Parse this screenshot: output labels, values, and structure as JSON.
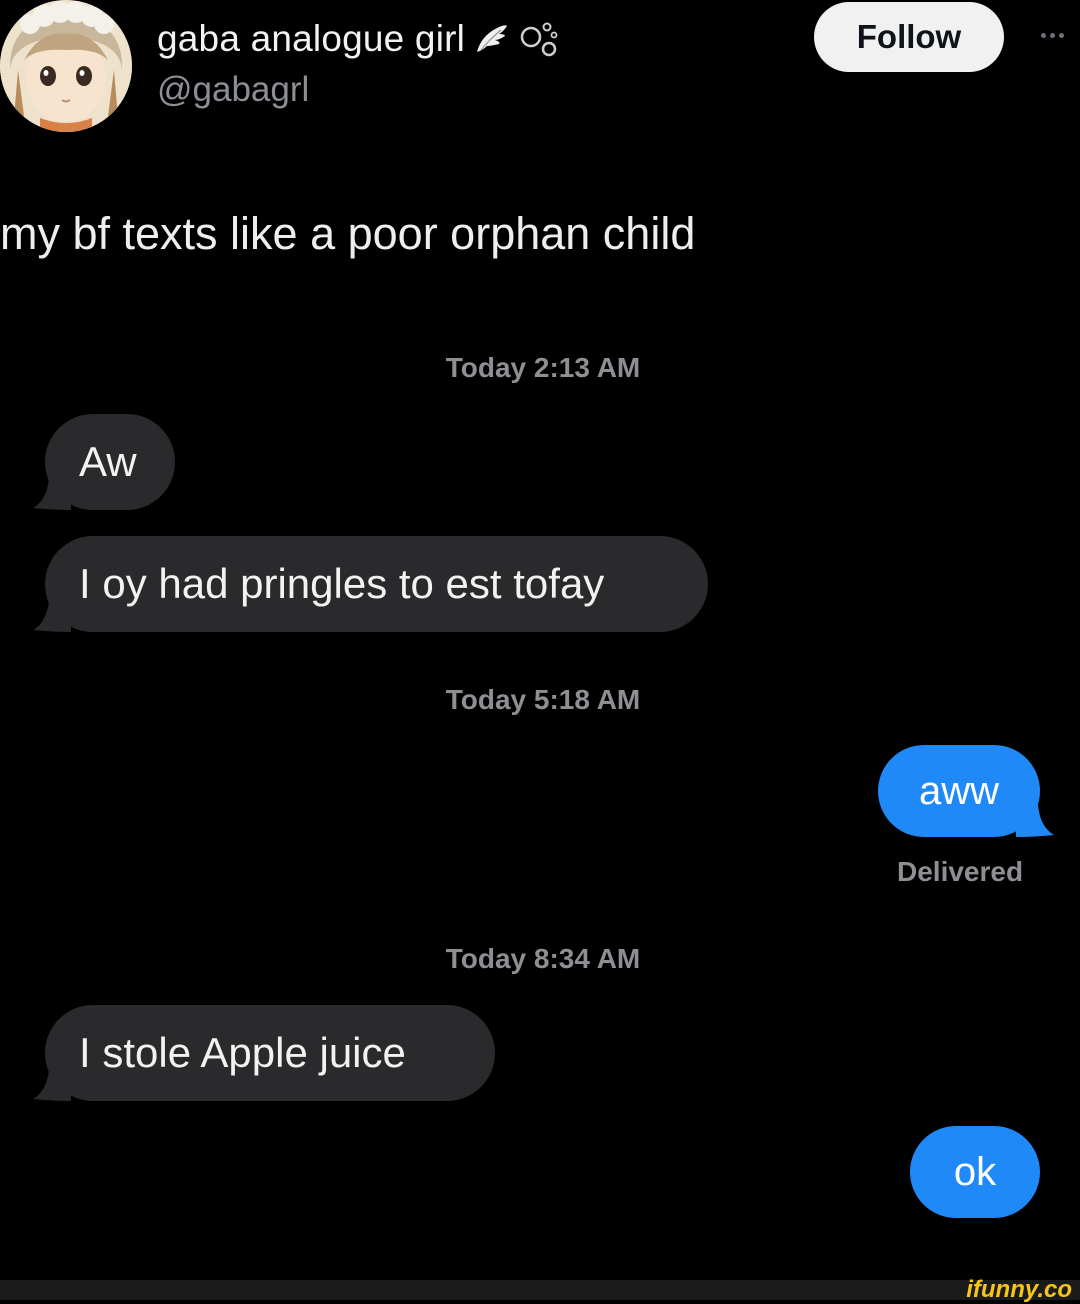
{
  "tweet": {
    "author": {
      "display_name": "gaba analogue girl",
      "handle": "@gabagrl",
      "avatar_icon": "anime-girl-avatar",
      "name_icons": [
        "angel-wing-icon",
        "bubbles-icon"
      ]
    },
    "follow_label": "Follow",
    "more_icon": "more-dots-icon",
    "text": "my bf texts like a poor orphan child"
  },
  "conversation": {
    "timestamps": [
      "Today 2:13 AM",
      "Today 5:18 AM",
      "Today 8:34 AM"
    ],
    "messages": [
      {
        "direction": "received",
        "text": "Aw"
      },
      {
        "direction": "received",
        "text": "I oy had pringles to est tofay"
      },
      {
        "direction": "sent",
        "text": "aww"
      },
      {
        "direction": "received",
        "text": "I stole Apple juice"
      },
      {
        "direction": "sent",
        "text": "ok"
      }
    ],
    "delivered_label": "Delivered"
  },
  "colors": {
    "background": "#000000",
    "received_bubble": "#2a2a2c",
    "sent_bubble": "#1f8af7",
    "follow_button": "#f1f1f1",
    "meta_text": "#8e8e93"
  },
  "watermark": "ifunny.co"
}
